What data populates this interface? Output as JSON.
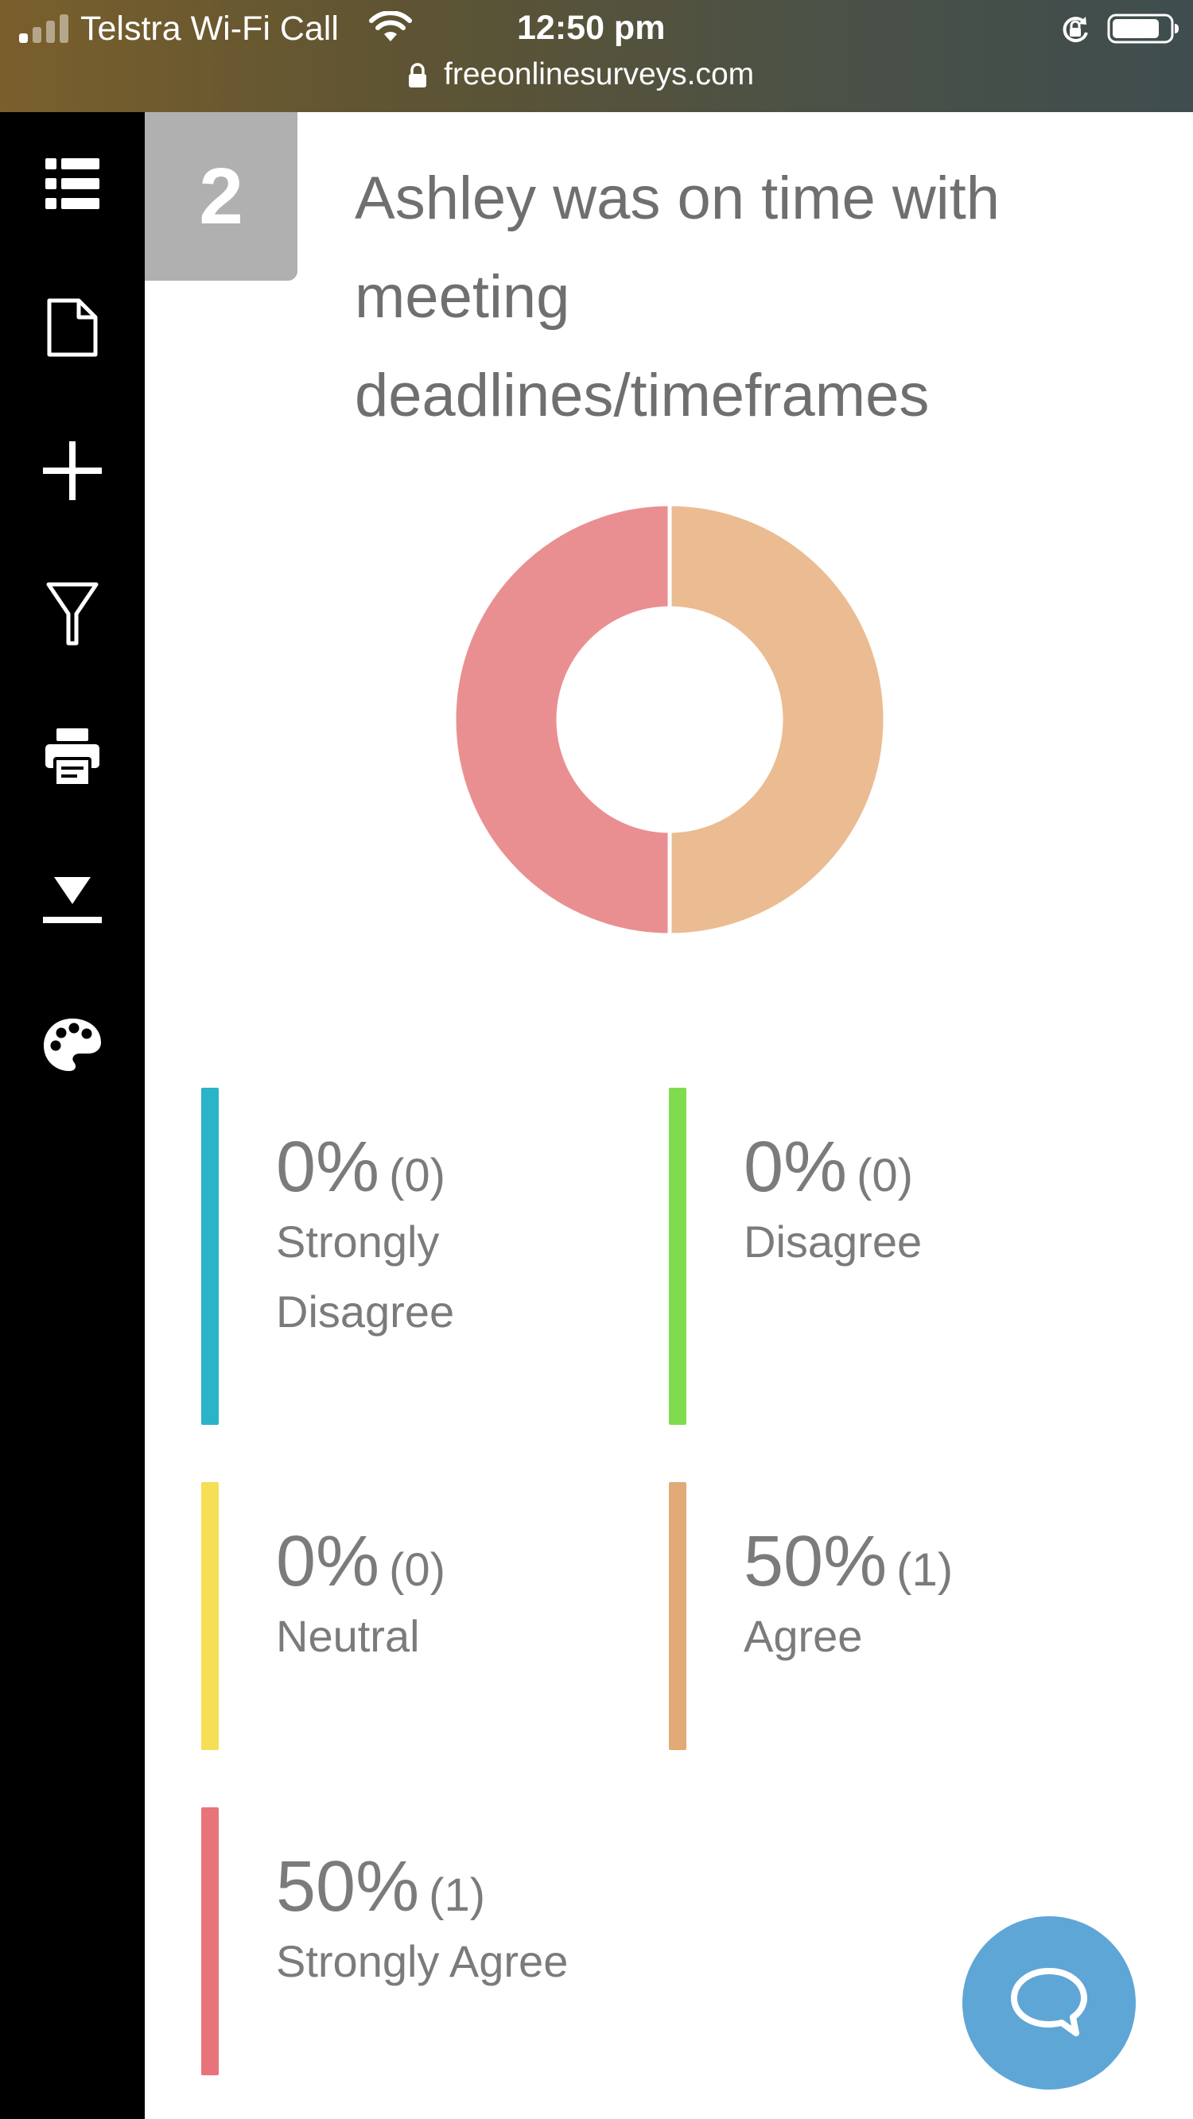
{
  "status_bar": {
    "carrier": "Telstra Wi-Fi Call",
    "time": "12:50 pm",
    "url": "freeonlinesurveys.com"
  },
  "sidebar": {
    "items": [
      {
        "icon": "list-icon"
      },
      {
        "icon": "document-icon"
      },
      {
        "icon": "plus-icon"
      },
      {
        "icon": "filter-icon"
      },
      {
        "icon": "print-icon"
      },
      {
        "icon": "download-icon"
      },
      {
        "icon": "palette-icon"
      }
    ]
  },
  "question": {
    "number": "2",
    "title": "Ashley was on time with meeting deadlines/timeframes"
  },
  "chart_data": {
    "type": "pie",
    "donut": true,
    "categories": [
      "Strongly Disagree",
      "Disagree",
      "Neutral",
      "Agree",
      "Strongly Agree"
    ],
    "values": [
      0,
      0,
      0,
      1,
      1
    ],
    "percentages": [
      0,
      0,
      0,
      50,
      50
    ],
    "colors": [
      "#2ab3c9",
      "#80dc4f",
      "#f5df57",
      "#e1aa76",
      "#e8737a"
    ],
    "slice_colors": {
      "Agree": "#ebbc91",
      "Strongly Agree": "#ea8f91"
    },
    "legend": [
      {
        "pct": "0%",
        "count": "(0)",
        "label": "Strongly Disagree",
        "color": "#2ab3c9"
      },
      {
        "pct": "0%",
        "count": "(0)",
        "label": "Disagree",
        "color": "#80dc4f"
      },
      {
        "pct": "0%",
        "count": "(0)",
        "label": "Neutral",
        "color": "#f5df57"
      },
      {
        "pct": "50%",
        "count": "(1)",
        "label": "Agree",
        "color": "#e1aa76"
      },
      {
        "pct": "50%",
        "count": "(1)",
        "label": "Strongly Agree",
        "color": "#e8737a"
      }
    ]
  },
  "chat": {
    "icon": "chat-icon"
  }
}
